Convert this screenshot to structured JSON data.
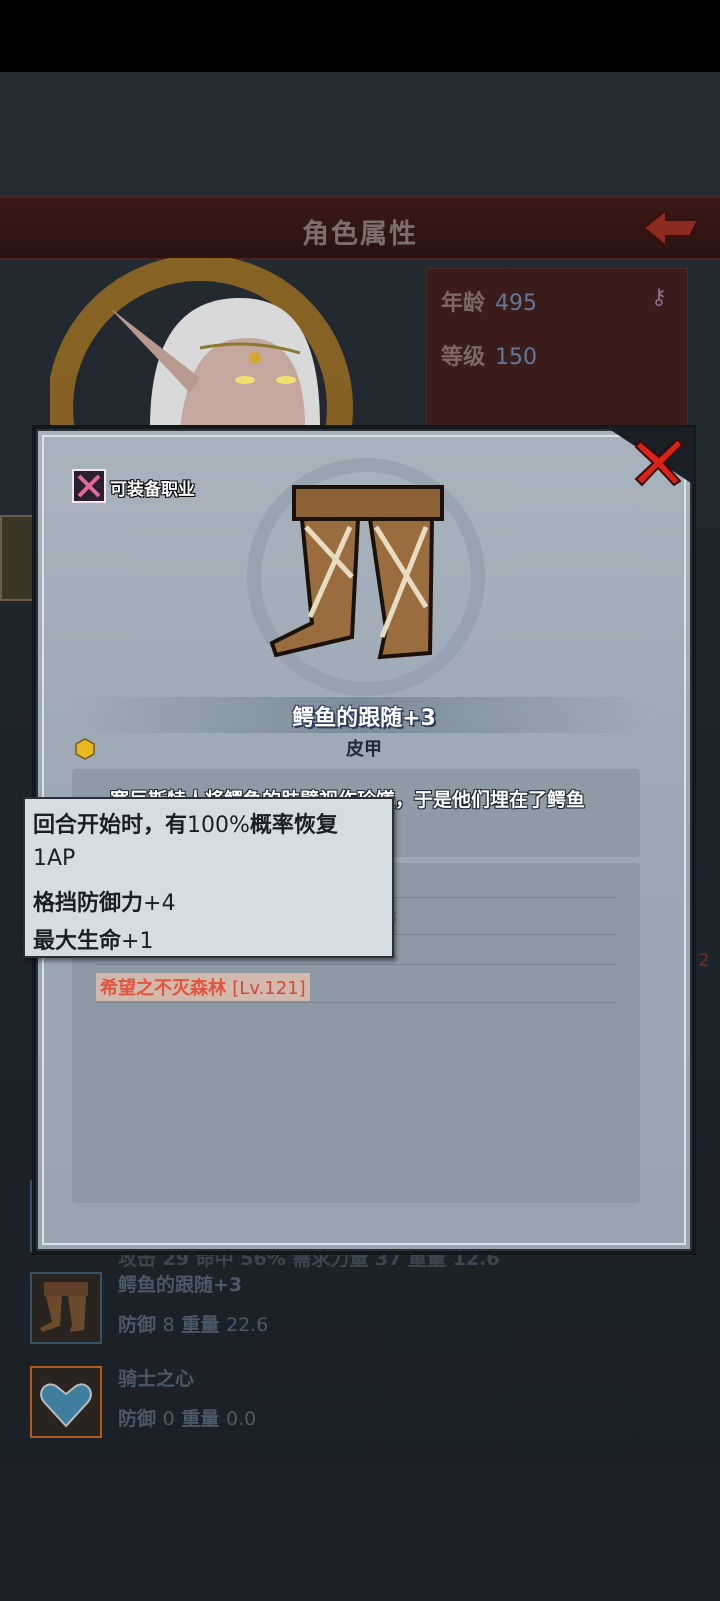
{
  "header": {
    "title": "角色属性"
  },
  "character": {
    "age_label": "年龄",
    "age_value": "495",
    "level_label": "等级",
    "level_value": "150"
  },
  "equipment_list": [
    {
      "name": "",
      "stats": "攻击 29 命中 56% 需求力量 37 重量 12.6"
    },
    {
      "name": "鳄鱼的跟随+3",
      "defense_label": "防御",
      "defense_value": "8",
      "weight_label": "重量",
      "weight_value": "22.6"
    },
    {
      "name": "骑士之心",
      "defense_label": "防御",
      "defense_value": "0",
      "weight_label": "重量",
      "weight_value": "0.0"
    }
  ],
  "side_number": "2",
  "modal": {
    "class_tag": "可装备职业",
    "item_name": "鳄鱼的跟随+3",
    "item_type": "皮甲",
    "description": "塞巨斯特人将鳄鱼的肤壁视作珍馐，于是他们埋在了鳄鱼",
    "partial_stat": "3",
    "set_name": "希望之不灭森林",
    "set_level": "[Lv.121]"
  },
  "tooltip": {
    "line1_prefix": "回合开始时，有",
    "line1_value": "100%",
    "line1_suffix": "概率恢复",
    "line2": "1AP",
    "line3_label": "格挡防御力",
    "line3_value": "+4",
    "line4_label": "最大生命",
    "line4_value": "+1"
  },
  "icons": {
    "back": "back-arrow-icon",
    "close": "close-icon",
    "class": "crossed-weapons-icon",
    "gem": "gem-icon",
    "item": "leather-boots-icon",
    "key": "key-icon"
  },
  "colors": {
    "accent_red": "#e3543e",
    "header_bg": "#3a1a16",
    "modal_bg": "#a8b3be"
  }
}
